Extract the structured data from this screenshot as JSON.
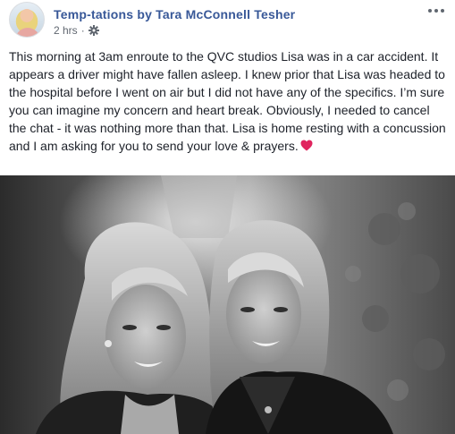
{
  "post": {
    "author": "Temp-tations by Tara McConnell Tesher",
    "timestamp": "2 hrs",
    "separator": "·",
    "privacy_icon": "gear-icon",
    "menu_icon": "more-icon",
    "body": "This morning at 3am enroute to the QVC studios Lisa was in a car accident. It appears a driver might have fallen asleep. I knew prior that Lisa was headed to the hospital before I went on air but I did not have any of the specifics. I’m sure you can imagine my concern and heart break. Obviously, I needed to cancel the chat - it was nothing more than that. Lisa is home resting with a concussion and I am asking for you to send your love & prayers.",
    "emoji": "heart-icon",
    "link_color": "#385898",
    "meta_color": "#606770"
  },
  "photo": {
    "style": "black-and-white",
    "subject_icon": "two-women-photo"
  }
}
